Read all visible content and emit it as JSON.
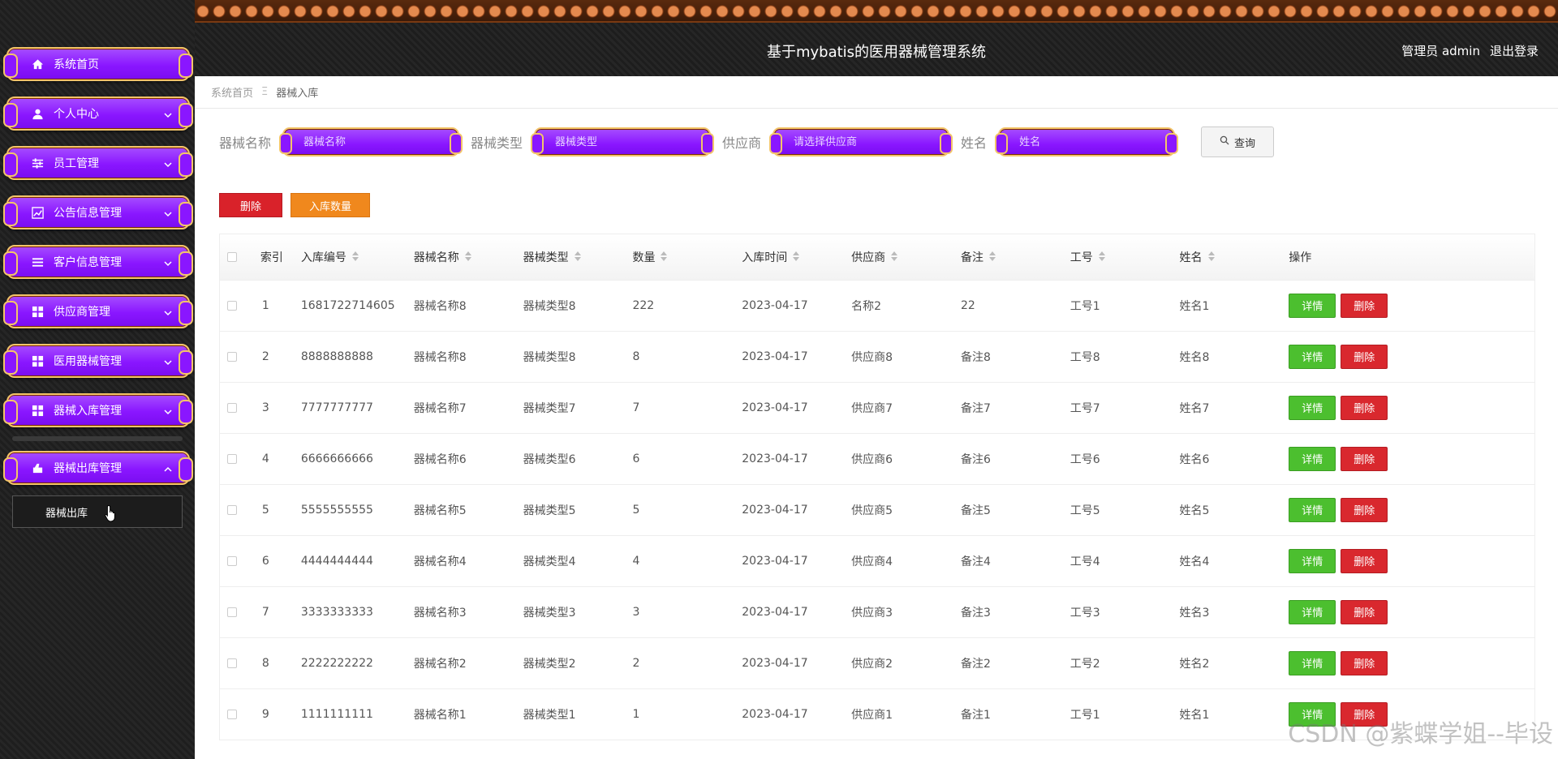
{
  "header": {
    "title": "基于mybatis的医用器械管理系统",
    "user": "管理员 admin",
    "logout": "退出登录"
  },
  "sidebar": {
    "items": [
      {
        "label": "系统首页",
        "icon": "home-icon",
        "expandable": false
      },
      {
        "label": "个人中心",
        "icon": "user-icon",
        "expandable": true
      },
      {
        "label": "员工管理",
        "icon": "sliders-icon",
        "expandable": true
      },
      {
        "label": "公告信息管理",
        "icon": "chart-icon",
        "expandable": true
      },
      {
        "label": "客户信息管理",
        "icon": "list-icon",
        "expandable": true
      },
      {
        "label": "供应商管理",
        "icon": "grid-icon",
        "expandable": true
      },
      {
        "label": "医用器械管理",
        "icon": "grid-icon",
        "expandable": true
      },
      {
        "label": "器械入库管理",
        "icon": "grid-icon",
        "expandable": true
      },
      {
        "label": "器械出库管理",
        "icon": "box-icon",
        "expandable": true,
        "open": true
      }
    ],
    "submenu": {
      "label": "器械出库"
    }
  },
  "breadcrumb": {
    "home": "系统首页",
    "separator": "Ξ",
    "current": "器械入库"
  },
  "search": {
    "name_label": "器械名称",
    "name_placeholder": "器械名称",
    "type_label": "器械类型",
    "type_placeholder": "器械类型",
    "supplier_label": "供应商",
    "supplier_placeholder": "请选择供应商",
    "person_label": "姓名",
    "person_placeholder": "姓名",
    "button": "查询"
  },
  "actions": {
    "delete": "删除",
    "stock_qty": "入库数量"
  },
  "table": {
    "headers": [
      "索引",
      "入库编号",
      "器械名称",
      "器械类型",
      "数量",
      "入库时间",
      "供应商",
      "备注",
      "工号",
      "姓名",
      "操作"
    ],
    "detail_label": "详情",
    "delete_label": "删除",
    "rows": [
      [
        "1",
        "1681722714605",
        "器械名称8",
        "器械类型8",
        "222",
        "2023-04-17",
        "名称2",
        "22",
        "工号1",
        "姓名1"
      ],
      [
        "2",
        "8888888888",
        "器械名称8",
        "器械类型8",
        "8",
        "2023-04-17",
        "供应商8",
        "备注8",
        "工号8",
        "姓名8"
      ],
      [
        "3",
        "7777777777",
        "器械名称7",
        "器械类型7",
        "7",
        "2023-04-17",
        "供应商7",
        "备注7",
        "工号7",
        "姓名7"
      ],
      [
        "4",
        "6666666666",
        "器械名称6",
        "器械类型6",
        "6",
        "2023-04-17",
        "供应商6",
        "备注6",
        "工号6",
        "姓名6"
      ],
      [
        "5",
        "5555555555",
        "器械名称5",
        "器械类型5",
        "5",
        "2023-04-17",
        "供应商5",
        "备注5",
        "工号5",
        "姓名5"
      ],
      [
        "6",
        "4444444444",
        "器械名称4",
        "器械类型4",
        "4",
        "2023-04-17",
        "供应商4",
        "备注4",
        "工号4",
        "姓名4"
      ],
      [
        "7",
        "3333333333",
        "器械名称3",
        "器械类型3",
        "3",
        "2023-04-17",
        "供应商3",
        "备注3",
        "工号3",
        "姓名3"
      ],
      [
        "8",
        "2222222222",
        "器械名称2",
        "器械类型2",
        "2",
        "2023-04-17",
        "供应商2",
        "备注2",
        "工号2",
        "姓名2"
      ],
      [
        "9",
        "1111111111",
        "器械名称1",
        "器械类型1",
        "1",
        "2023-04-17",
        "供应商1",
        "备注1",
        "工号1",
        "姓名1"
      ]
    ]
  },
  "watermark": "CSDN @紫蝶学姐--毕设",
  "colors": {
    "menu_purple": "#8a16ff",
    "menu_border": "#f3c46a",
    "detail_green": "#4cbf2f",
    "delete_red": "#d9222a",
    "stock_orange": "#f0881d"
  }
}
